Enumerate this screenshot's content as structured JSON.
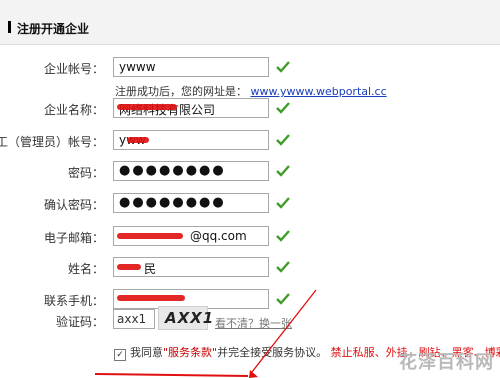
{
  "header": {
    "title": "注册开通企业"
  },
  "fields": [
    {
      "id": "account",
      "label": "企业帐号：",
      "value": "ywww"
    },
    {
      "id": "company",
      "label": "企业名称：",
      "value": "网络科技有限公司"
    },
    {
      "id": "admin",
      "label": "员工（管理员）帐号：",
      "value": "yww"
    },
    {
      "id": "password",
      "label": "密码：",
      "value": "●●●●●●●●"
    },
    {
      "id": "confirm",
      "label": "确认密码：",
      "value": "●●●●●●●●"
    },
    {
      "id": "email",
      "label": "电子邮箱：",
      "value": "@qq.com"
    },
    {
      "id": "name",
      "label": "姓名：",
      "value": "民"
    },
    {
      "id": "phone",
      "label": "联系手机：",
      "value": ""
    }
  ],
  "hint": {
    "text": "注册成功后，您的网址是：",
    "link": "www.ywww.webportal.cc"
  },
  "captcha": {
    "label": "验证码：",
    "value": "axx1",
    "image_text": "AXX1",
    "refresh_text": "看不清？换一张"
  },
  "agreement": {
    "prefix": "我同意",
    "terms": "\"服务条款\"",
    "suffix": "并完全接受服务协议。",
    "warning": "禁止私服、外挂、刷钻、黑客、博彩..."
  },
  "watermark": "花泽百科网",
  "colors": {
    "accent_red": "#e01010",
    "link_blue": "#1a3fb8",
    "check_green": "#3f9e2a"
  }
}
